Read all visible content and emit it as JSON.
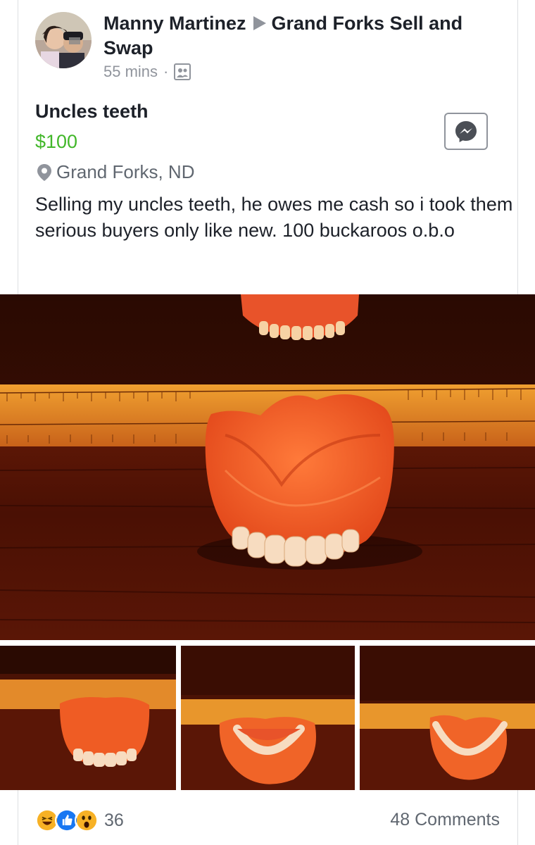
{
  "post": {
    "author": "Manny Martinez",
    "group": "Grand Forks Sell and Swap",
    "time": "55 mins",
    "separator": "·"
  },
  "listing": {
    "title": "Uncles teeth",
    "price": "$100",
    "location": "Grand Forks, ND",
    "description": "Selling my uncles teeth, he owes me cash so i took them serious buyers only like new. 100 buckaroos o.b.o"
  },
  "footer": {
    "reaction_count": "36",
    "comments": "48 Comments",
    "reactions": [
      "haha-icon",
      "like-icon",
      "wow-icon"
    ]
  },
  "icons": {
    "group": "group-icon",
    "location": "location-pin-icon",
    "messenger": "messenger-icon"
  },
  "colors": {
    "price": "#42b72a",
    "meta": "#90949c",
    "like_blue": "#1877f2",
    "reaction_yellow": "#f7b125"
  }
}
